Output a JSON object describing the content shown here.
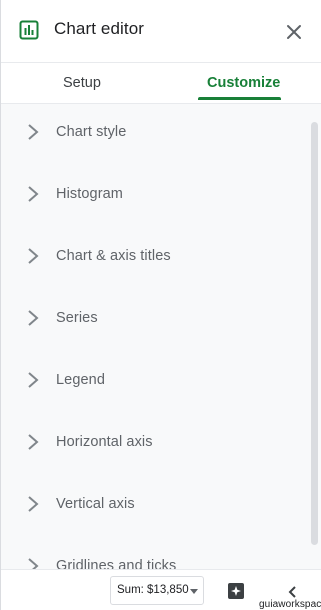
{
  "header": {
    "title": "Chart editor",
    "icon": "chart-bar-icon",
    "close_icon": "close-icon"
  },
  "tabs": [
    {
      "label": "Setup",
      "active": false
    },
    {
      "label": "Customize",
      "active": true
    }
  ],
  "colors": {
    "accent": "#188038",
    "text": "#3c4043",
    "muted": "#5f6368",
    "panel_bg": "#f8f9fa"
  },
  "sections": [
    {
      "label": "Chart style"
    },
    {
      "label": "Histogram"
    },
    {
      "label": "Chart & axis titles"
    },
    {
      "label": "Series"
    },
    {
      "label": "Legend"
    },
    {
      "label": "Horizontal axis"
    },
    {
      "label": "Vertical axis"
    },
    {
      "label": "Gridlines and ticks"
    }
  ],
  "footer": {
    "sum_label": "Sum: $13,850",
    "explore_icon": "explore-icon",
    "collapse_icon": "chevron-left-icon",
    "watermark": "guiaworkspace"
  }
}
